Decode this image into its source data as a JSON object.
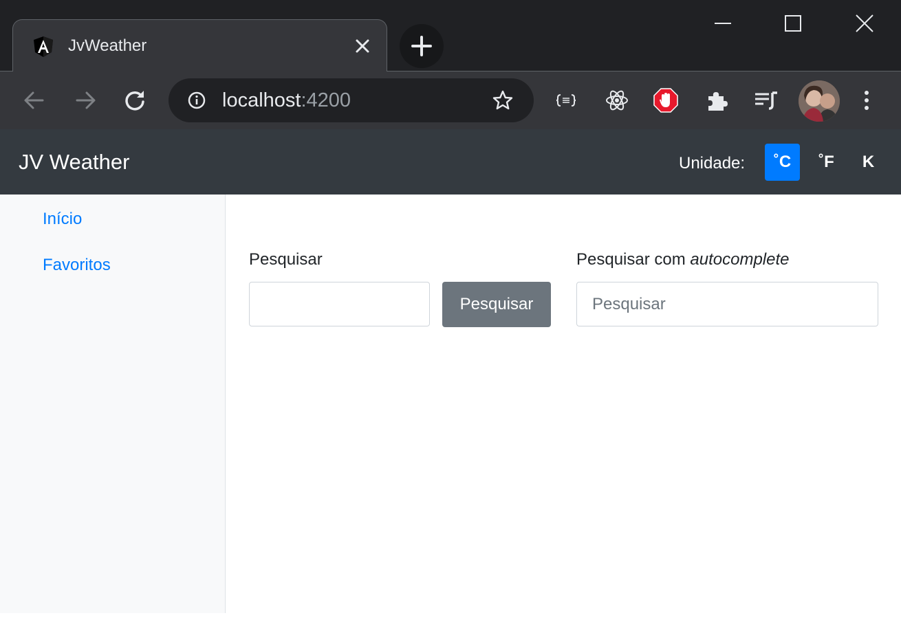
{
  "browser": {
    "tab_title": "JvWeather",
    "address_host": "localhost",
    "address_port": ":4200"
  },
  "app": {
    "brand": "JV Weather",
    "unit_label": "Unidade:",
    "units": [
      "˚C",
      "˚F",
      "K"
    ],
    "active_unit": "˚C",
    "accent_color": "#007bff"
  },
  "sidebar": {
    "items": [
      {
        "label": "Início"
      },
      {
        "label": "Favoritos"
      }
    ]
  },
  "search": {
    "label": "Pesquisar",
    "value": "",
    "button_label": "Pesquisar"
  },
  "autocomplete": {
    "label_prefix": "Pesquisar com ",
    "label_emphasis": "autocomplete",
    "placeholder": "Pesquisar"
  }
}
